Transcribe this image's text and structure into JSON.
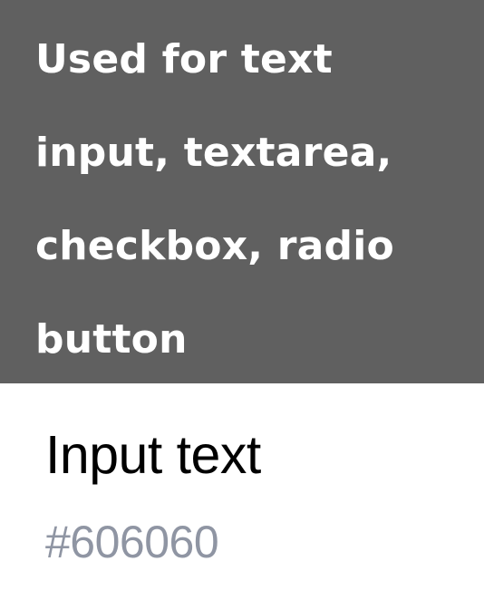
{
  "swatch": {
    "color": "#606060",
    "description": "Used for text input, textarea, checkbox, radio button"
  },
  "info": {
    "title": "Input text",
    "hex": "#606060",
    "hex_text_color": "#8f95a3"
  }
}
